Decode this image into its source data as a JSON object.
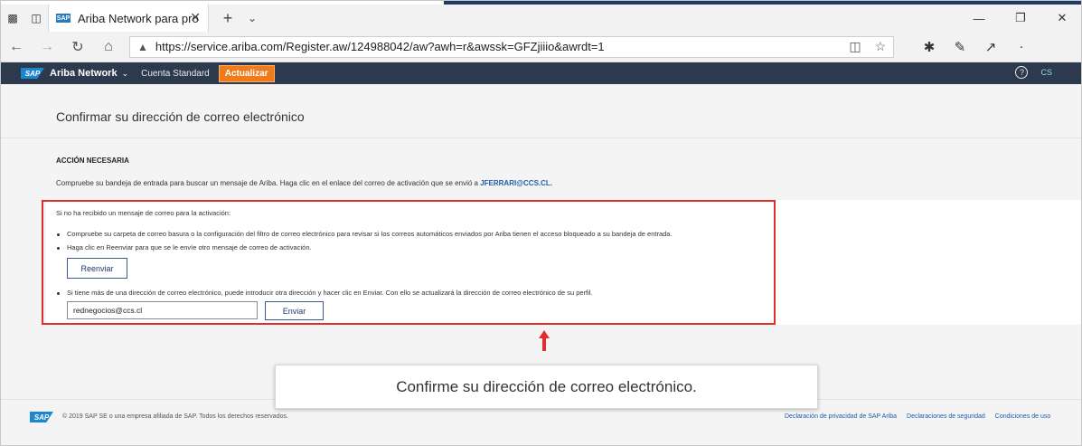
{
  "browser": {
    "tab_title": "Ariba Network para pro",
    "tab_favicon": "SAP",
    "url": "https://service.ariba.com/Register.aw/124988042/aw?awh=r&awssk=GFZjiiio&awrdt=1"
  },
  "header": {
    "logo": "SAP",
    "app_name": "Ariba Network",
    "account": "Cuenta Standard",
    "upgrade_label": "Actualizar",
    "help_icon": "?",
    "user_initials": "CS",
    "bg_color": "#2d3a4d",
    "accent_color": "#f07b1a"
  },
  "main": {
    "title": "Confirmar su dirección de correo electrónico",
    "section_heading": "ACCIÓN NECESARIA",
    "instructions": "Compruebe su bandeja de entrada para buscar un mensaje de Ariba. Haga clic en el enlace del correo de activación que se envió a",
    "email_highlight": "JFERRARI@CCS.CL.",
    "panel": {
      "intro": "Si no ha recibido un mensaje de correo para la activación:",
      "bullet1": "Compruebe su carpeta de correo basura o la configuración del filtro de correo electrónico para revisar si los correos automáticos enviados por Ariba tienen el acceso bloqueado a su bandeja de entrada.",
      "bullet2": "Haga clic en Reenviar para que se le envíe otro mensaje de correo de activación.",
      "resend_label": "Reenviar",
      "bullet3": "Si tiene más de una dirección de correo electrónico, puede introducir otra dirección y hacer clic en Enviar. Con ello se actualizará la dirección de correo electrónico de su perfil.",
      "email_value": "rednegocios@ccs.cl",
      "send_label": "Enviar"
    }
  },
  "callout": {
    "text": "Confirme su dirección de correo electrónico."
  },
  "footer": {
    "logo": "SAP",
    "copyright": "© 2019 SAP SE o una empresa afiliada de SAP. Todos los derechos reservados.",
    "links": [
      "Declaración de privacidad de SAP Ariba",
      "Declaraciones de seguridad",
      "Condiciones de uso"
    ]
  },
  "colors": {
    "highlight_box": "#e22d2d",
    "link": "#1f5da8"
  }
}
